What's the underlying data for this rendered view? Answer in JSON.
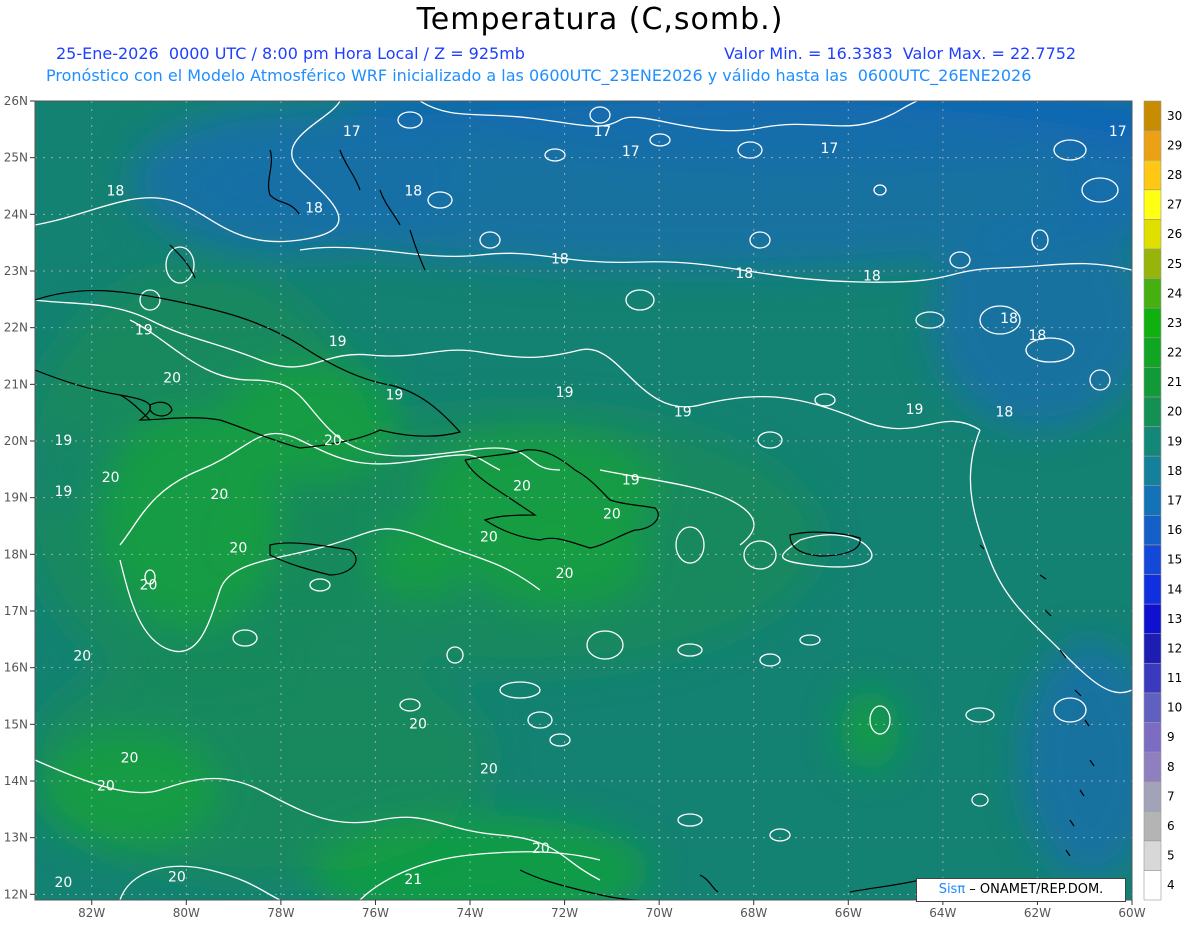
{
  "header": {
    "title": "Temperatura (C,somb.)",
    "line1": "25-Ene-2026  0000 UTC / 8:00 pm Hora Local / Z = 925mb",
    "minmax": "Valor Min. = 16.3383  Valor Max. = 22.7752",
    "line2": "Pronóstico con el Modelo Atmosférico WRF inicializado a las 0600UTC_23ENE2026 y válido hasta las  0600UTC_26ENE2026"
  },
  "map": {
    "lon_labels": [
      "82W",
      "80W",
      "78W",
      "76W",
      "74W",
      "72W",
      "70W",
      "68W",
      "66W",
      "64W",
      "62W",
      "60W"
    ],
    "lat_labels": [
      "26N",
      "25N",
      "24N",
      "23N",
      "22N",
      "21N",
      "20N",
      "19N",
      "18N",
      "17N",
      "16N",
      "15N",
      "14N",
      "13N",
      "12N"
    ],
    "lon_range": [
      -83.2,
      -60
    ],
    "lat_range": [
      11.9,
      26
    ],
    "contour_labels": [
      {
        "text": "17",
        "lon": -76.5,
        "lat": 25.45
      },
      {
        "text": "17",
        "lon": -71.2,
        "lat": 25.45
      },
      {
        "text": "17",
        "lon": -70.6,
        "lat": 25.1
      },
      {
        "text": "17",
        "lon": -66.4,
        "lat": 25.15
      },
      {
        "text": "17",
        "lon": -60.3,
        "lat": 25.45
      },
      {
        "text": "18",
        "lon": -81.5,
        "lat": 24.4
      },
      {
        "text": "18",
        "lon": -75.2,
        "lat": 24.4
      },
      {
        "text": "18",
        "lon": -77.3,
        "lat": 24.1
      },
      {
        "text": "18",
        "lon": -72.1,
        "lat": 23.2
      },
      {
        "text": "18",
        "lon": -68.2,
        "lat": 22.95
      },
      {
        "text": "18",
        "lon": -65.5,
        "lat": 22.9
      },
      {
        "text": "18",
        "lon": -62.6,
        "lat": 22.15
      },
      {
        "text": "18",
        "lon": -62.0,
        "lat": 21.85
      },
      {
        "text": "18",
        "lon": -62.7,
        "lat": 20.5
      },
      {
        "text": "19",
        "lon": -80.9,
        "lat": 21.95
      },
      {
        "text": "19",
        "lon": -76.8,
        "lat": 21.75
      },
      {
        "text": "19",
        "lon": -75.6,
        "lat": 20.8
      },
      {
        "text": "19",
        "lon": -72.0,
        "lat": 20.85
      },
      {
        "text": "19",
        "lon": -69.5,
        "lat": 20.5
      },
      {
        "text": "19",
        "lon": -64.6,
        "lat": 20.55
      },
      {
        "text": "19",
        "lon": -82.6,
        "lat": 20.0
      },
      {
        "text": "19",
        "lon": -82.6,
        "lat": 19.1
      },
      {
        "text": "19",
        "lon": -70.6,
        "lat": 19.3
      },
      {
        "text": "20",
        "lon": -80.3,
        "lat": 21.1
      },
      {
        "text": "20",
        "lon": -76.9,
        "lat": 20.0
      },
      {
        "text": "20",
        "lon": -81.6,
        "lat": 19.35
      },
      {
        "text": "20",
        "lon": -79.3,
        "lat": 19.05
      },
      {
        "text": "20",
        "lon": -72.9,
        "lat": 19.2
      },
      {
        "text": "20",
        "lon": -71.0,
        "lat": 18.7
      },
      {
        "text": "20",
        "lon": -73.6,
        "lat": 18.3
      },
      {
        "text": "20",
        "lon": -78.9,
        "lat": 18.1
      },
      {
        "text": "20",
        "lon": -72.0,
        "lat": 17.65
      },
      {
        "text": "20",
        "lon": -80.8,
        "lat": 17.45
      },
      {
        "text": "20",
        "lon": -82.2,
        "lat": 16.2
      },
      {
        "text": "20",
        "lon": -75.1,
        "lat": 15.0
      },
      {
        "text": "20",
        "lon": -73.6,
        "lat": 14.2
      },
      {
        "text": "20",
        "lon": -81.2,
        "lat": 14.4
      },
      {
        "text": "20",
        "lon": -81.7,
        "lat": 13.9
      },
      {
        "text": "20",
        "lon": -72.5,
        "lat": 12.8
      },
      {
        "text": "20",
        "lon": -82.6,
        "lat": 12.2
      },
      {
        "text": "20",
        "lon": -80.2,
        "lat": 12.3
      },
      {
        "text": "21",
        "lon": -75.2,
        "lat": 12.25
      }
    ],
    "shading": {
      "base": "#148272",
      "warm_green": "#13a040",
      "mid_green": "#158a5c",
      "cool_blue": "#1470a8",
      "deep_blue": "#1160c2",
      "contour": "#ffffff",
      "coast": "#000000"
    }
  },
  "colorbar": {
    "labels": [
      "4",
      "5",
      "6",
      "7",
      "8",
      "9",
      "10",
      "11",
      "12",
      "13",
      "14",
      "15",
      "16",
      "17",
      "18",
      "19",
      "20",
      "21",
      "22",
      "23",
      "24",
      "25",
      "26",
      "27",
      "28",
      "29",
      "30"
    ],
    "colors": [
      "#ffffff",
      "#d8d8d8",
      "#b4b4b4",
      "#a2a2b8",
      "#8f7fc0",
      "#7c6cc4",
      "#5f60c0",
      "#3a3abf",
      "#1d1db3",
      "#1010d0",
      "#1030e0",
      "#1448d8",
      "#1460c8",
      "#1472b6",
      "#14809c",
      "#148878",
      "#149055",
      "#129a38",
      "#10a623",
      "#10b010",
      "#46b010",
      "#96b40a",
      "#e0e000",
      "#ffff14",
      "#ffc814",
      "#eca014",
      "#c88c00"
    ]
  },
  "credit": {
    "brand": "Sisπ",
    "org": " – ONAMET/REP.DOM."
  }
}
